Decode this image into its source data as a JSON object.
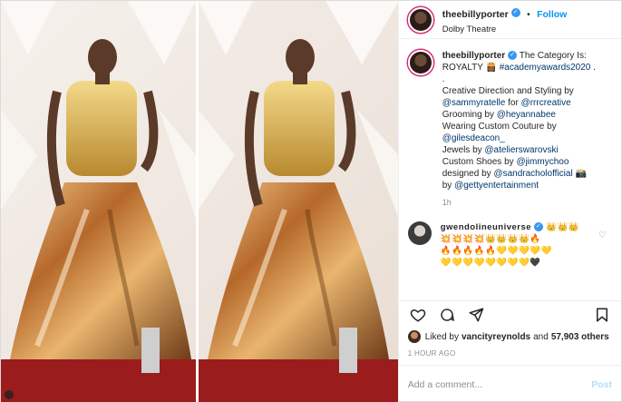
{
  "post_header": {
    "username": "theebillyporter",
    "separator": "•",
    "follow_label": "Follow",
    "location": "Dolby Theatre"
  },
  "caption": {
    "username": "theebillyporter",
    "line1": "The Category Is: ROYALTY 👸🏾",
    "tag_awards": "#academyawards2020",
    "after_tag": " .",
    "dot": ".",
    "creative_text": "Creative Direction and Styling by",
    "creative_user": "@sammyratelle",
    "for_text": " for ",
    "creative_user2": "@rrrcreative",
    "grooming_text": "Grooming by ",
    "grooming_user": "@heyannabee",
    "wearing_text": "Wearing Custom Couture by",
    "couture_user": "@gilesdeacon_",
    "jewels_text": "Jewels by ",
    "jewels_user": "@atelierswarovski",
    "shoes_text": "Custom Shoes by ",
    "shoes_user": "@jimmychoo",
    "designed_text": "designed by ",
    "designed_user": "@sandracholofficial",
    "camera_emoji": " 📸",
    "photo_text": "by ",
    "photo_user": "@gettyentertainment",
    "time": "1h"
  },
  "comment": {
    "username": "gwendolineuniverse",
    "emoji_line1": " 👑👑👑",
    "emoji_line2": "💥💥💥💥👑👑👑👑🔥",
    "emoji_line3": "🔥🔥🔥🔥🔥💛💛💛💛💛",
    "emoji_line4": "💛💛💛💛💛💛💛💛🖤"
  },
  "likes": {
    "prefix": "Liked by ",
    "user": "vancityreynolds",
    "middle": " and ",
    "count": "57,903 others"
  },
  "posted_ago": "1 HOUR AGO",
  "add_comment": {
    "placeholder": "Add a comment...",
    "post_label": "Post"
  },
  "icons": {
    "like": "heart-icon",
    "comment": "comment-icon",
    "share": "share-icon",
    "save": "bookmark-icon"
  }
}
